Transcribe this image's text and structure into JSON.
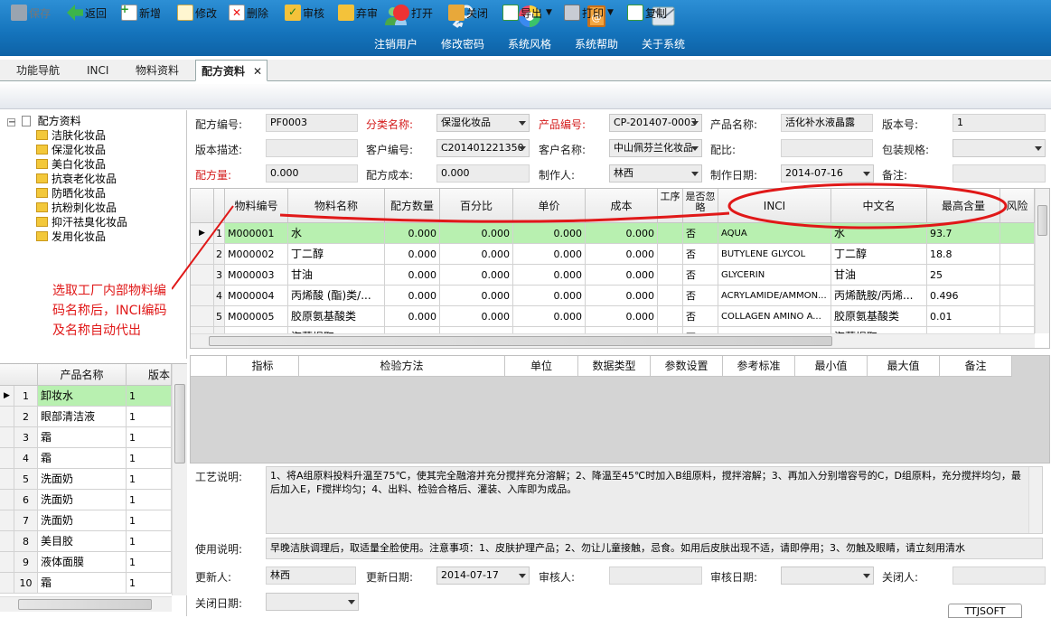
{
  "topbar": {
    "buttons": [
      {
        "label": "注销用户",
        "icon": "users-icon"
      },
      {
        "label": "修改密码",
        "icon": "key-icon"
      },
      {
        "label": "系统风格",
        "icon": "color-wheel-icon"
      },
      {
        "label": "系统帮助",
        "icon": "help-book-icon"
      },
      {
        "label": "关于系统",
        "icon": "envelope-icon"
      }
    ]
  },
  "tabs": [
    "功能导航",
    "INCI",
    "物料资料",
    "配方资料"
  ],
  "toolbar": {
    "buttons": [
      "保存",
      "返回",
      "新增",
      "修改",
      "删除",
      "审核",
      "弃审",
      "打开",
      "关闭",
      "导出",
      "打印",
      "复制"
    ]
  },
  "tree": {
    "root": "配方资料",
    "items": [
      "洁肤化妆品",
      "保湿化妆品",
      "美白化妆品",
      "抗衰老化妆品",
      "防晒化妆品",
      "抗粉刺化妆品",
      "抑汗祛臭化妆品",
      "发用化妆品"
    ]
  },
  "product_list": {
    "headers": [
      "产品名称",
      "版本"
    ],
    "rows": [
      {
        "n": "1",
        "name": "卸妆水",
        "ver": "1"
      },
      {
        "n": "2",
        "name": "眼部清洁液",
        "ver": "1"
      },
      {
        "n": "3",
        "name": "霜",
        "ver": "1"
      },
      {
        "n": "4",
        "name": "霜",
        "ver": "1"
      },
      {
        "n": "5",
        "name": "洗面奶",
        "ver": "1"
      },
      {
        "n": "6",
        "name": "洗面奶",
        "ver": "1"
      },
      {
        "n": "7",
        "name": "洗面奶",
        "ver": "1"
      },
      {
        "n": "8",
        "name": "美目胶",
        "ver": "1"
      },
      {
        "n": "9",
        "name": "液体面膜",
        "ver": "1"
      },
      {
        "n": "10",
        "name": "霜",
        "ver": "1"
      }
    ]
  },
  "form": {
    "formula_no_label": "配方编号:",
    "formula_no": "PF0003",
    "category_label": "分类名称:",
    "category": "保湿化妆品",
    "product_no_label": "产品编号:",
    "product_no": "CP-201407-0003",
    "product_name_label": "产品名称:",
    "product_name": "活化补水液晶露",
    "version_label": "版本号:",
    "version": "1",
    "desc_label": "版本描述:",
    "desc": "",
    "customer_no_label": "客户编号:",
    "customer_no": "C201401221350",
    "customer_name_label": "客户名称:",
    "customer_name": "中山佩芬兰化妆品",
    "ratio_label": "配比:",
    "ratio": "",
    "spec_label": "包装规格:",
    "spec": "",
    "amount_label": "配方量:",
    "amount": "0.000",
    "cost_label": "配方成本:",
    "cost": "0.000",
    "maker_label": "制作人:",
    "maker": "林西",
    "make_date_label": "制作日期:",
    "make_date": "2014-07-16",
    "remark_label": "备注:",
    "remark": ""
  },
  "materials": {
    "headers": [
      "物料编号",
      "物料名称",
      "配方数量",
      "百分比",
      "单价",
      "成本",
      "工序",
      "是否忽略",
      "INCI",
      "中文名",
      "最高含量",
      "风险"
    ],
    "rows": [
      {
        "n": "1",
        "code": "M000001",
        "name": "水",
        "qty": "0.000",
        "pct": "0.000",
        "price": "0.000",
        "cost": "0.000",
        "ign": "否",
        "inci": "AQUA",
        "cn": "水",
        "max": "93.7"
      },
      {
        "n": "2",
        "code": "M000002",
        "name": "丁二醇",
        "qty": "0.000",
        "pct": "0.000",
        "price": "0.000",
        "cost": "0.000",
        "ign": "否",
        "inci": "BUTYLENE GLYCOL",
        "cn": "丁二醇",
        "max": "18.8"
      },
      {
        "n": "3",
        "code": "M000003",
        "name": "甘油",
        "qty": "0.000",
        "pct": "0.000",
        "price": "0.000",
        "cost": "0.000",
        "ign": "否",
        "inci": "GLYCERIN",
        "cn": "甘油",
        "max": "25"
      },
      {
        "n": "4",
        "code": "M000004",
        "name": "丙烯酸 (酯)类/...",
        "qty": "0.000",
        "pct": "0.000",
        "price": "0.000",
        "cost": "0.000",
        "ign": "否",
        "inci": "ACRYLAMIDE/AMMON...",
        "cn": "丙烯酰胺/丙烯...",
        "max": "0.496"
      },
      {
        "n": "5",
        "code": "M000005",
        "name": "胶原氨基酸类",
        "qty": "0.000",
        "pct": "0.000",
        "price": "0.000",
        "cost": "0.000",
        "ign": "否",
        "inci": "COLLAGEN AMINO A...",
        "cn": "胶原氨基酸类",
        "max": "0.01"
      },
      {
        "n": "",
        "code": "",
        "name": "海藻提取",
        "qty": "",
        "pct": "",
        "price": "",
        "cost": "",
        "ign": "否",
        "inci": "",
        "cn": "海藻提取",
        "max": ""
      }
    ]
  },
  "inspection": {
    "headers": [
      "指标",
      "检验方法",
      "单位",
      "数据类型",
      "参数设置",
      "参考标准",
      "最小值",
      "最大值",
      "备注"
    ]
  },
  "process": {
    "label": "工艺说明:",
    "text": "1、将A组原料投料升温至75℃，使其完全融溶并充分搅拌充分溶解；2、降温至45℃时加入B组原料，搅拌溶解；3、再加入分别增容号的C，D组原料，充分搅拌均匀，最后加入E，F搅拌均匀；4、出料、检验合格后、灌装、入库即为成品。"
  },
  "usage": {
    "label": "使用说明:",
    "text": "早晚洁肤调理后，取适量全脸使用。注意事项：1、皮肤护理产品；2、勿让儿童接触，忌食。如用后皮肤出现不适，请即停用；3、勿触及眼睛，请立刻用清水"
  },
  "footer": {
    "updater_label": "更新人:",
    "updater": "林西",
    "update_date_label": "更新日期:",
    "update_date": "2014-07-17",
    "auditor_label": "审核人:",
    "auditor": "",
    "audit_date_label": "审核日期:",
    "audit_date": "",
    "closer_label": "关闭人:",
    "closer": "",
    "close_date_label": "关闭日期:",
    "close_date": ""
  },
  "annotation": {
    "lines": [
      "选取工厂内部物料编",
      "码名称后，INCI编码",
      "及名称自动代出"
    ]
  },
  "watermark": "TTJSOFT",
  "colors": {
    "topbar": "#1473bb",
    "selected_row": "#b8f0b0",
    "annotation": "#e01818",
    "required_label": "#d41b1b"
  }
}
